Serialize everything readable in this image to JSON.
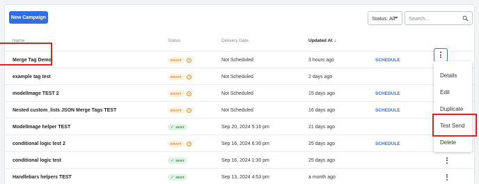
{
  "toolbar": {
    "new_campaign_label": "New Campaign",
    "status_filter_value": "Status: All",
    "search_placeholder": "Search..."
  },
  "table": {
    "headers": {
      "name": "Name",
      "status": "Status",
      "delivery_date": "Delivery Date",
      "updated_at": "Updated At"
    },
    "rows": [
      {
        "name": "Merge Tag Demo",
        "status": "DRAFT",
        "delivery": "Not Scheduled",
        "updated": "3 hours ago",
        "action": "SCHEDULE"
      },
      {
        "name": "example tag test",
        "status": "DRAFT",
        "delivery": "Not Scheduled",
        "updated": "2 days ago",
        "action": ""
      },
      {
        "name": "modelImage TEST 2",
        "status": "DRAFT",
        "delivery": "Not Scheduled",
        "updated": "15 days ago",
        "action": "SCHEDULE"
      },
      {
        "name": "Nested custom_lists JSON Merge Tags TEST",
        "status": "DRAFT",
        "delivery": "Not Scheduled",
        "updated": "16 days ago",
        "action": "SCHEDULE"
      },
      {
        "name": "ModelImage helper TEST",
        "status": "SENT",
        "delivery": "Sep 20, 2024 5:16 pm",
        "updated": "21 days ago",
        "action": ""
      },
      {
        "name": "conditional logic test 2",
        "status": "DRAFT",
        "delivery": "Sep 16, 2024 6:30 pm",
        "updated": "25 days ago",
        "action": "SCHEDULE"
      },
      {
        "name": "conditional logic test",
        "status": "SENT",
        "delivery": "Sep 16, 2024 1:30 pm",
        "updated": "25 days ago",
        "action": ""
      },
      {
        "name": "Handlebars helpers TEST",
        "status": "SENT",
        "delivery": "Sep 13, 2024 4:53 pm",
        "updated": "a month ago",
        "action": ""
      }
    ]
  },
  "context_menu": {
    "items": [
      "Details",
      "Edit",
      "Duplicate",
      "Test Send",
      "Delete"
    ]
  },
  "colors": {
    "accent": "#2f6fe0",
    "draft_bg": "#fdf0d8",
    "draft_text": "#d48a12",
    "sent_bg": "#ddf3e4",
    "sent_text": "#2e8a4c",
    "highlight": "#e02020"
  },
  "icons": {
    "search": "search-icon",
    "sort": "arrow-down-icon",
    "help": "help-circle-icon",
    "sent": "check-icon",
    "more": "kebab-menu-icon"
  }
}
